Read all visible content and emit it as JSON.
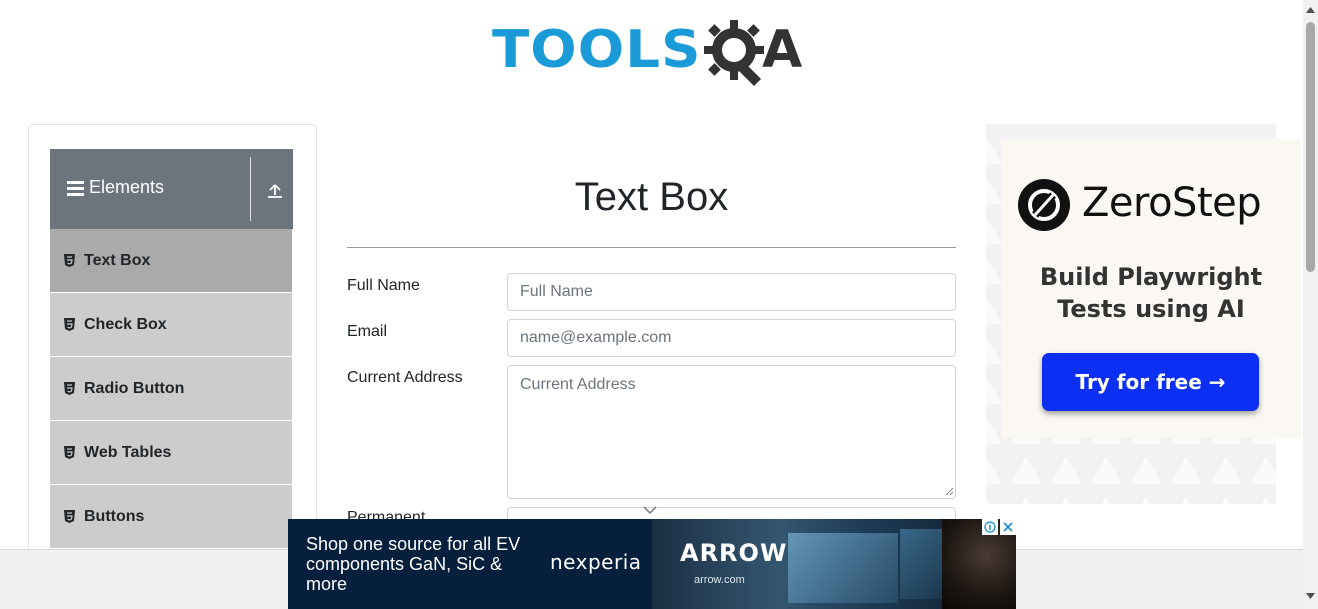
{
  "header": {
    "logo_text_left": "TOOLS",
    "logo_text_right": "A",
    "logo_icon": "gear-q-icon",
    "brand_colors": {
      "tools": "#1a9bd7",
      "qa": "#333333"
    }
  },
  "sidebar": {
    "group_title": "Elements",
    "group_icon": "menu-icon",
    "collapse_icon": "upload-icon",
    "items": [
      {
        "label": "Text Box",
        "icon": "html5-icon",
        "active": true
      },
      {
        "label": "Check Box",
        "icon": "html5-icon",
        "active": false
      },
      {
        "label": "Radio Button",
        "icon": "html5-icon",
        "active": false
      },
      {
        "label": "Web Tables",
        "icon": "html5-icon",
        "active": false
      },
      {
        "label": "Buttons",
        "icon": "html5-icon",
        "active": false
      }
    ]
  },
  "main": {
    "title": "Text Box",
    "fields": {
      "full_name": {
        "label": "Full Name",
        "placeholder": "Full Name",
        "value": ""
      },
      "email": {
        "label": "Email",
        "placeholder": "name@example.com",
        "value": ""
      },
      "current_address": {
        "label": "Current Address",
        "placeholder": "Current Address",
        "value": ""
      },
      "permanent_address": {
        "label": "Permanent"
      }
    }
  },
  "right_ad": {
    "brand": "ZeroStep",
    "tagline_line1": "Build Playwright",
    "tagline_line2": "Tests using AI",
    "cta": "Try for free →",
    "cta_color": "#0b2ff3"
  },
  "bottom_ad": {
    "headline": "Shop one source for all EV components GaN, SiC & more",
    "sponsor": "nexperia",
    "partner": "ARROW",
    "partner_url": "arrow.com"
  }
}
